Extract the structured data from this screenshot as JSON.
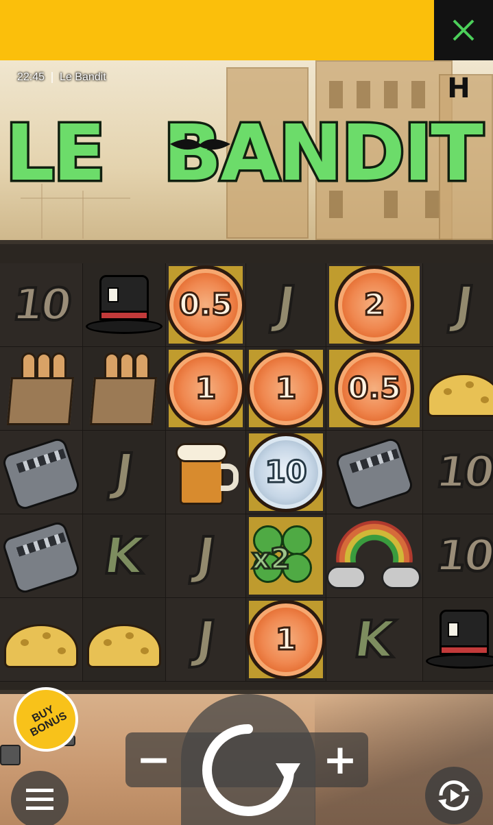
{
  "status_bar": {
    "time": "22:45",
    "app_name": "Le Bandit"
  },
  "banner": {
    "color": "#fbbf0b",
    "close_icon": "close-icon"
  },
  "logo": {
    "word1": "LE",
    "word2": "BANDIT",
    "color": "#6cdc6a"
  },
  "provider_logo": "H",
  "reels": [
    [
      {
        "type": "ten",
        "text": "10"
      },
      {
        "type": "hat"
      },
      {
        "type": "coin",
        "text": "0.5",
        "bg": "gold"
      },
      {
        "type": "j",
        "text": "J"
      },
      {
        "type": "coin",
        "text": "2",
        "bg": "gold"
      },
      {
        "type": "j",
        "text": "J"
      }
    ],
    [
      {
        "type": "bread"
      },
      {
        "type": "bread"
      },
      {
        "type": "coin",
        "text": "1",
        "bg": "gold"
      },
      {
        "type": "coin",
        "text": "1",
        "bg": "gold"
      },
      {
        "type": "coin",
        "text": "0.5",
        "bg": "gold"
      },
      {
        "type": "cheese"
      }
    ],
    [
      {
        "type": "trap"
      },
      {
        "type": "j",
        "text": "J"
      },
      {
        "type": "beer"
      },
      {
        "type": "coin-silver",
        "text": "10",
        "bg": "gold"
      },
      {
        "type": "trap"
      },
      {
        "type": "ten",
        "text": "10"
      }
    ],
    [
      {
        "type": "trap"
      },
      {
        "type": "k",
        "text": "K"
      },
      {
        "type": "j",
        "text": "J"
      },
      {
        "type": "clover",
        "text": "x2",
        "bg": "gold"
      },
      {
        "type": "rainbow"
      },
      {
        "type": "ten",
        "text": "10"
      }
    ],
    [
      {
        "type": "cheese"
      },
      {
        "type": "cheese"
      },
      {
        "type": "j",
        "text": "J"
      },
      {
        "type": "coin",
        "text": "1",
        "bg": "gold"
      },
      {
        "type": "k",
        "text": "K"
      },
      {
        "type": "hat"
      }
    ]
  ],
  "controls": {
    "buy_bonus_line1": "BUY",
    "buy_bonus_line2": "BONUS",
    "minus": "−",
    "plus": "+",
    "spin_icon": "spin-icon",
    "menu_icon": "hamburger-menu-icon",
    "autoplay_icon": "autoplay-icon"
  }
}
